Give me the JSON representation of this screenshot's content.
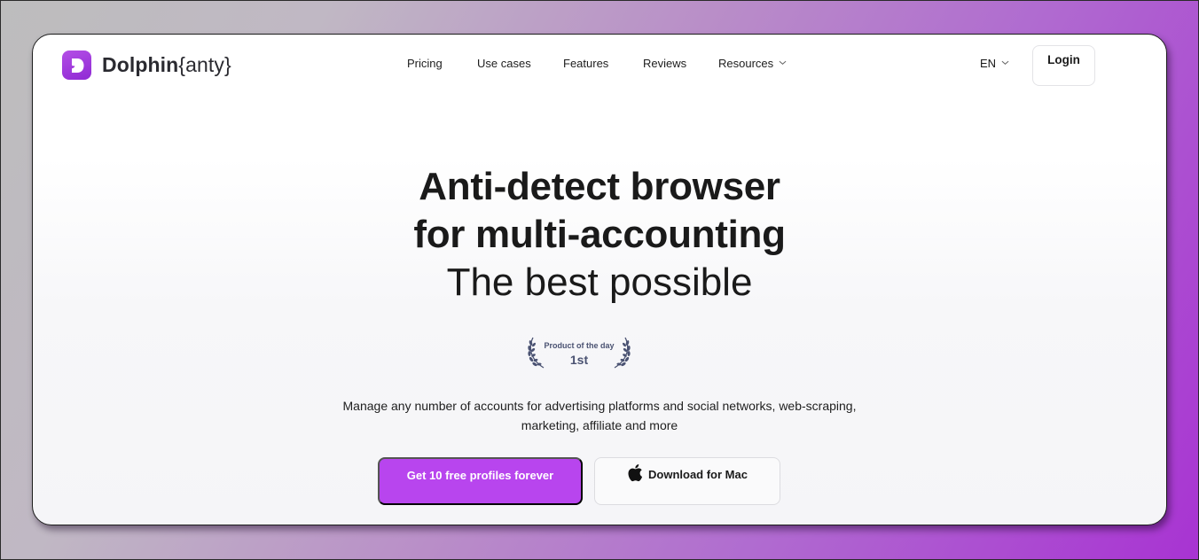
{
  "brand": {
    "name_bold": "Dolphin",
    "name_light": "{anty}",
    "accent": "#b845ee",
    "logo_icon": "dolphin-d-logo"
  },
  "nav": {
    "items": [
      {
        "label": "Pricing"
      },
      {
        "label": "Use cases"
      },
      {
        "label": "Features"
      },
      {
        "label": "Reviews"
      },
      {
        "label": "Resources",
        "has_dropdown": true
      }
    ],
    "language": "EN",
    "login_label": "Login"
  },
  "hero": {
    "title_line1": "Anti-detect browser",
    "title_line2": "for multi-accounting",
    "title_line3": "The best possible",
    "badge": {
      "caption": "Product of the day",
      "rank": "1st",
      "icon": "laurel-wreath-icon"
    },
    "description_line1": "Manage any number of accounts for advertising platforms and social networks, web-scraping,",
    "description_line2": "marketing, affiliate and more",
    "primary_cta": "Get 10 free profiles forever",
    "secondary_cta": "Download for Mac",
    "secondary_cta_icon": "apple-icon"
  }
}
